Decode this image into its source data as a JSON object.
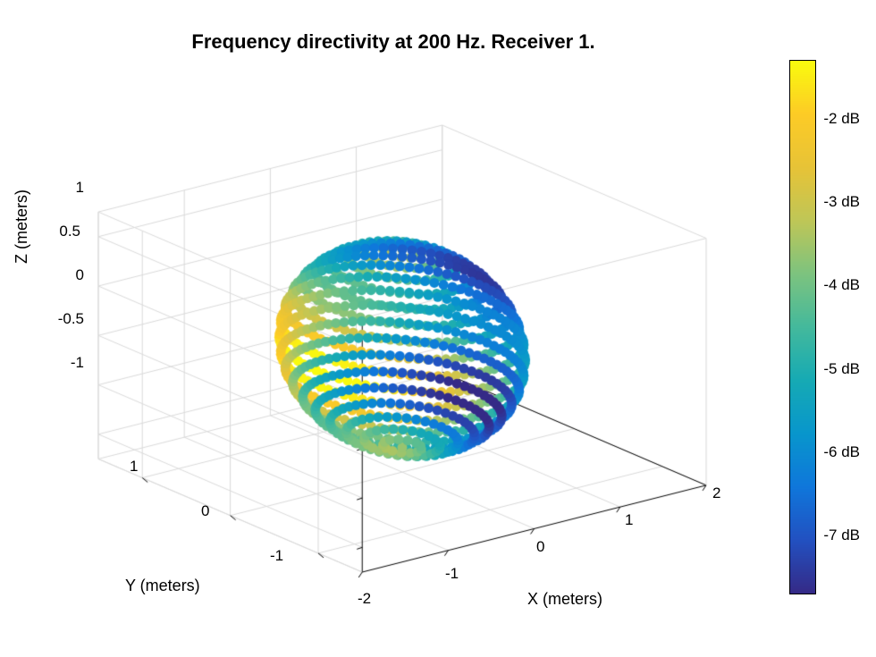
{
  "chart_data": {
    "type": "scatter",
    "title": "Frequency directivity at 200 Hz. Receiver 1.",
    "xlabel": "X (meters)",
    "ylabel": "Y (meters)",
    "zlabel": "Z (meters)",
    "x_ticks": [
      -2,
      -1,
      0,
      1,
      2
    ],
    "y_ticks": [
      -1,
      0,
      1
    ],
    "z_ticks": [
      -1,
      -0.5,
      0,
      0.5,
      1
    ],
    "colorbar_ticks": [
      -2,
      -3,
      -4,
      -5,
      -6,
      -7
    ],
    "colorbar_tick_labels": [
      "-2 dB",
      "-3 dB",
      "-4 dB",
      "-5 dB",
      "-6 dB",
      "-7 dB"
    ],
    "colorbar_range": [
      -7.7,
      -1.3
    ],
    "description": "3D scatter of points arranged in latitude rings on a unit sphere, colored by directivity in dB (parula colormap). Mid-latitude rings on the front-right show deep blue (~-6 to -7 dB), left/back region shows yellow/orange (~-2 to -3 dB), poles and many rings are teal/green (~-4 to -5 dB).",
    "sphere": {
      "radius": 1.0,
      "latitude_count": 20,
      "points_per_full_ring": 80
    },
    "azimuth_deg": -37.5,
    "elevation_deg": 30
  }
}
